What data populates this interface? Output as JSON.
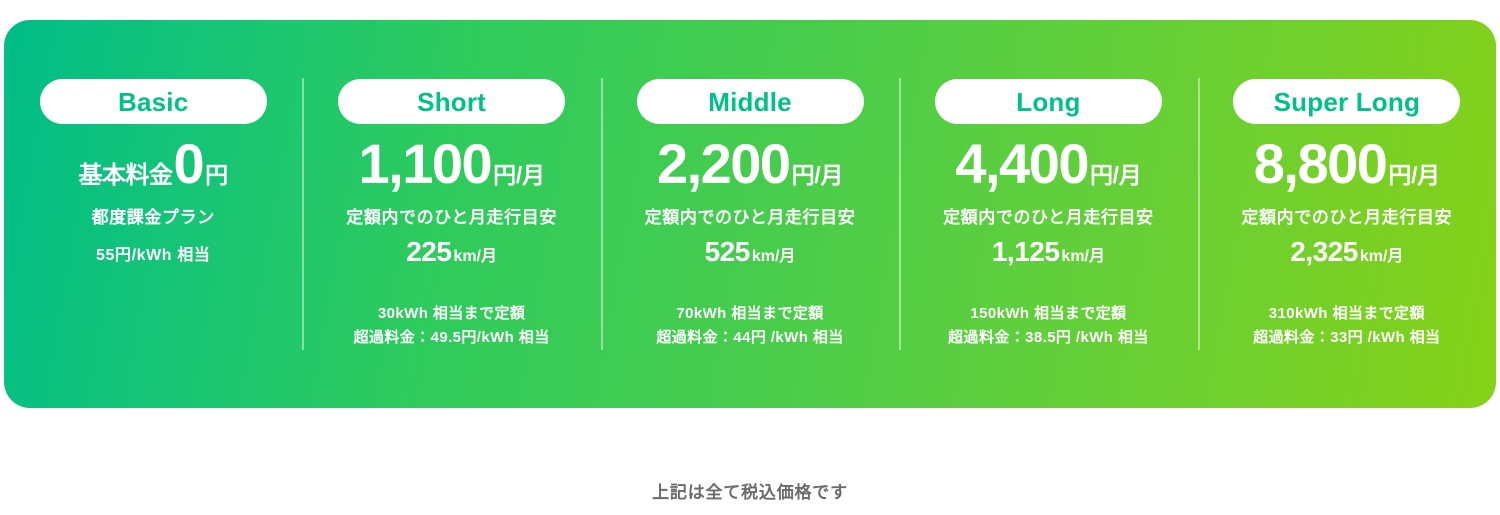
{
  "card": {
    "gradient_start": "#00bd87",
    "gradient_mid": "#46cc4e",
    "gradient_end": "#85d116",
    "badge_text_color": "#00c08b",
    "badge_bg_color": "#ffffff",
    "text_color": "#ffffff"
  },
  "plans": [
    {
      "badge": "Basic",
      "price_prefix": "基本料金",
      "price_main": "0",
      "price_unit": "円",
      "note": "都度課金プラン",
      "distance_value": "",
      "distance_unit": "",
      "distance_caption": "",
      "included_line": "55円/kWh 相当",
      "overage_line": ""
    },
    {
      "badge": "Short",
      "price_prefix": "",
      "price_main": "1,100",
      "price_unit": "円/月",
      "note": "",
      "distance_caption": "定額内でのひと月走行目安",
      "distance_value": "225",
      "distance_unit": "km/月",
      "included_line": "30kWh 相当まで定額",
      "overage_line": "超過料金：49.5円/kWh 相当"
    },
    {
      "badge": "Middle",
      "price_prefix": "",
      "price_main": "2,200",
      "price_unit": "円/月",
      "note": "",
      "distance_caption": "定額内でのひと月走行目安",
      "distance_value": "525",
      "distance_unit": "km/月",
      "included_line": "70kWh 相当まで定額",
      "overage_line": "超過料金：44円 /kWh 相当"
    },
    {
      "badge": "Long",
      "price_prefix": "",
      "price_main": "4,400",
      "price_unit": "円/月",
      "note": "",
      "distance_caption": "定額内でのひと月走行目安",
      "distance_value": "1,125",
      "distance_unit": "km/月",
      "included_line": "150kWh 相当まで定額",
      "overage_line": "超過料金：38.5円 /kWh 相当"
    },
    {
      "badge": "Super Long",
      "price_prefix": "",
      "price_main": "8,800",
      "price_unit": "円/月",
      "note": "",
      "distance_caption": "定額内でのひと月走行目安",
      "distance_value": "2,325",
      "distance_unit": "km/月",
      "included_line": "310kWh 相当まで定額",
      "overage_line": "超過料金：33円 /kWh 相当"
    }
  ],
  "footer": {
    "tax_note": "上記は全て税込価格です"
  }
}
